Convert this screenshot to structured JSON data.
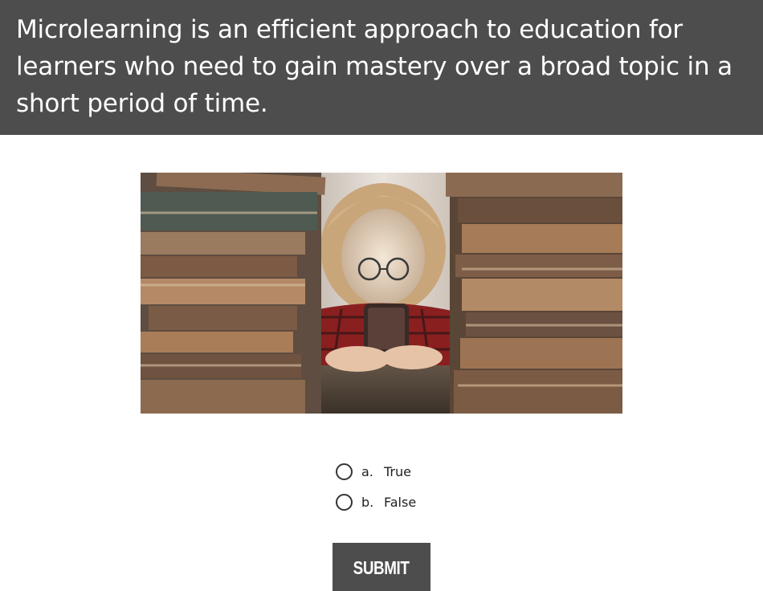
{
  "question": {
    "text": "Microlearning is an efficient approach to education for learners who need to gain mastery over a broad topic in a short period of time."
  },
  "image": {
    "description_icon": "student-with-books-photo"
  },
  "options": [
    {
      "letter": "a.",
      "label": "True",
      "selected": false
    },
    {
      "letter": "b.",
      "label": "False",
      "selected": false
    }
  ],
  "submit": {
    "label": "SUBMIT"
  },
  "colors": {
    "bar": "#4d4d4d",
    "text_on_bar": "#ffffff",
    "background": "#ffffff"
  }
}
